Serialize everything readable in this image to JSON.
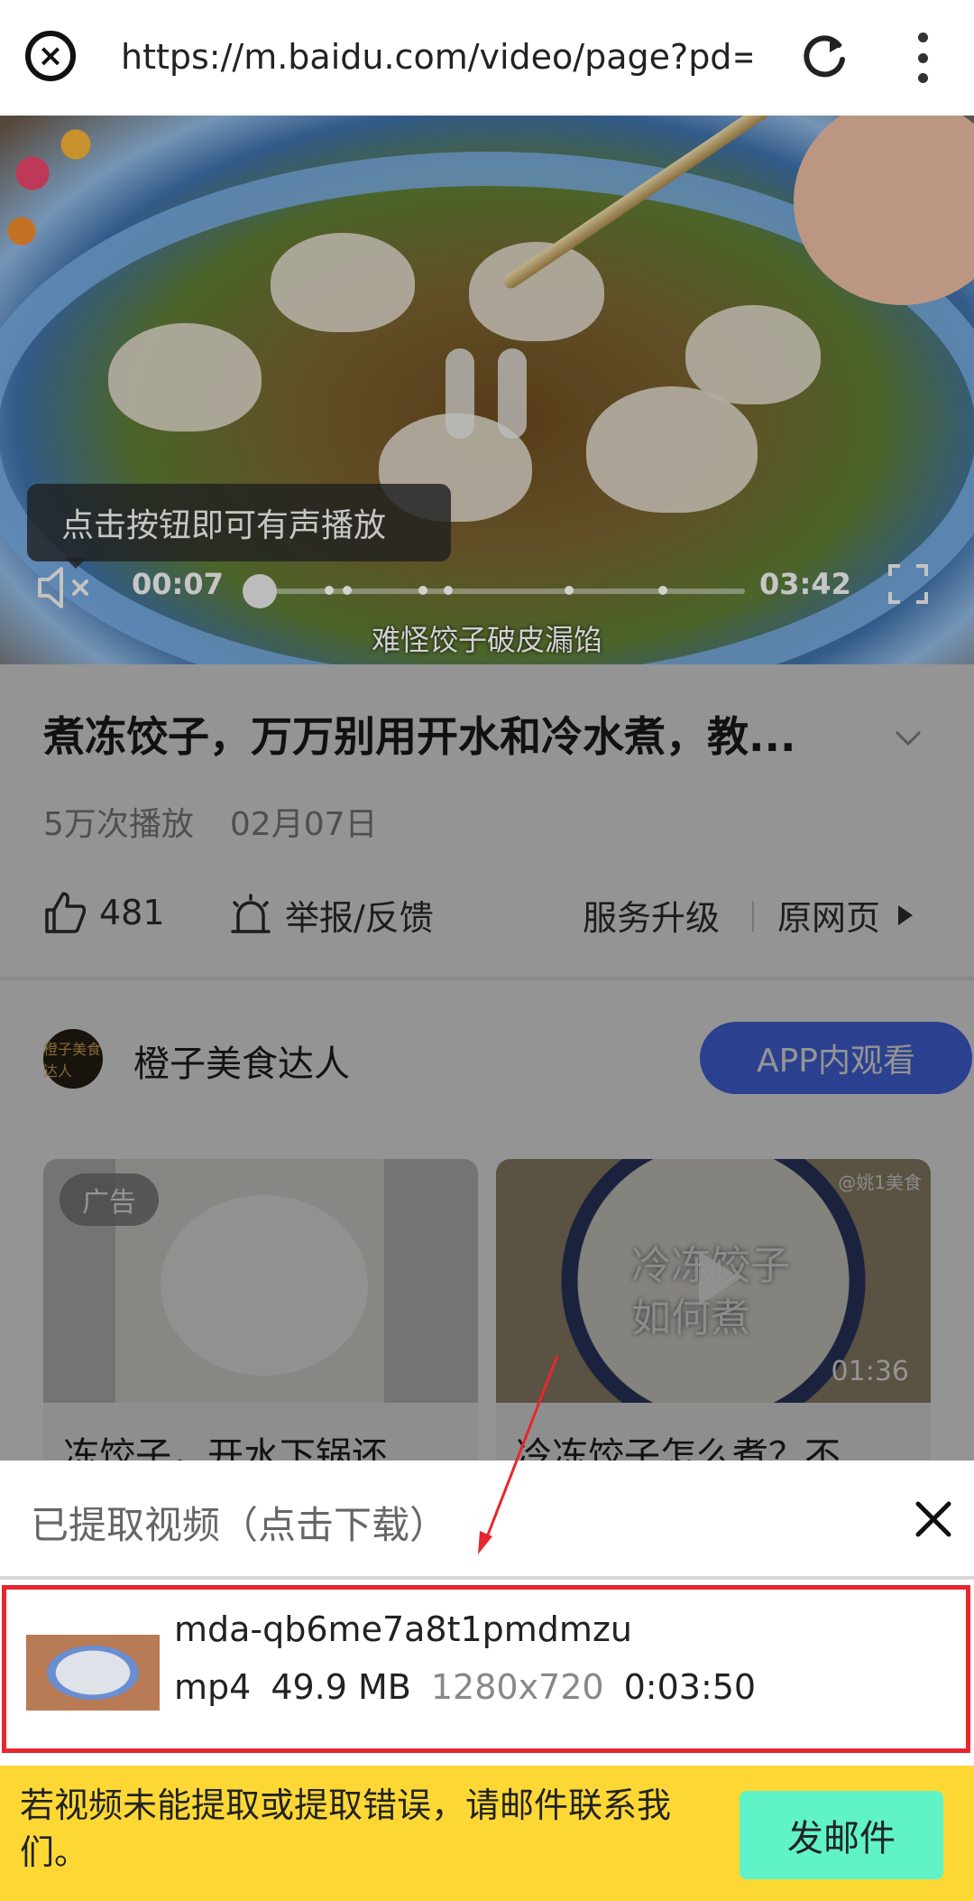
{
  "browser": {
    "url": "https://m.baidu.com/video/page?pd=vid"
  },
  "video": {
    "tooltip": "点击按钮即可有声播放",
    "current_time": "00:07",
    "duration": "03:42",
    "progress": 0.032,
    "subtitle": "难怪饺子破皮漏馅"
  },
  "page": {
    "title": "煮冻饺子，万万别用开水和冷水煮，教...",
    "play_count": "5万次播放",
    "date": "02月07日",
    "like_count": "481",
    "report_label": "举报/反馈",
    "service_label": "服务升级",
    "original_label": "原网页",
    "author_name": "橙子美食达人",
    "author_avatar_text": "橙子美食达人",
    "app_button": "APP内观看",
    "cards": [
      {
        "tag": "广告",
        "title": "冻饺子，开水下锅还"
      },
      {
        "watermark": "@姚1美食",
        "overlay_text": "冷冻饺子如何煮",
        "duration": "01:36",
        "title": "冷冻饺子怎么煮？不"
      }
    ]
  },
  "panel": {
    "title": "已提取视频（点击下载）",
    "item": {
      "filename": "mda-qb6me7a8t1pmdmzu",
      "format": "mp4",
      "size": "49.9 MB",
      "resolution": "1280x720",
      "length": "0:03:50"
    }
  },
  "footer": {
    "message": "若视频未能提取或提取错误，请邮件联系我们。",
    "mail_button": "发邮件"
  },
  "colors": {
    "highlight_border": "#e8262d",
    "footer_bg": "#fdd835",
    "mail_button_bg": "#5ff3c7",
    "app_button_bg": "#4b6ef5"
  }
}
